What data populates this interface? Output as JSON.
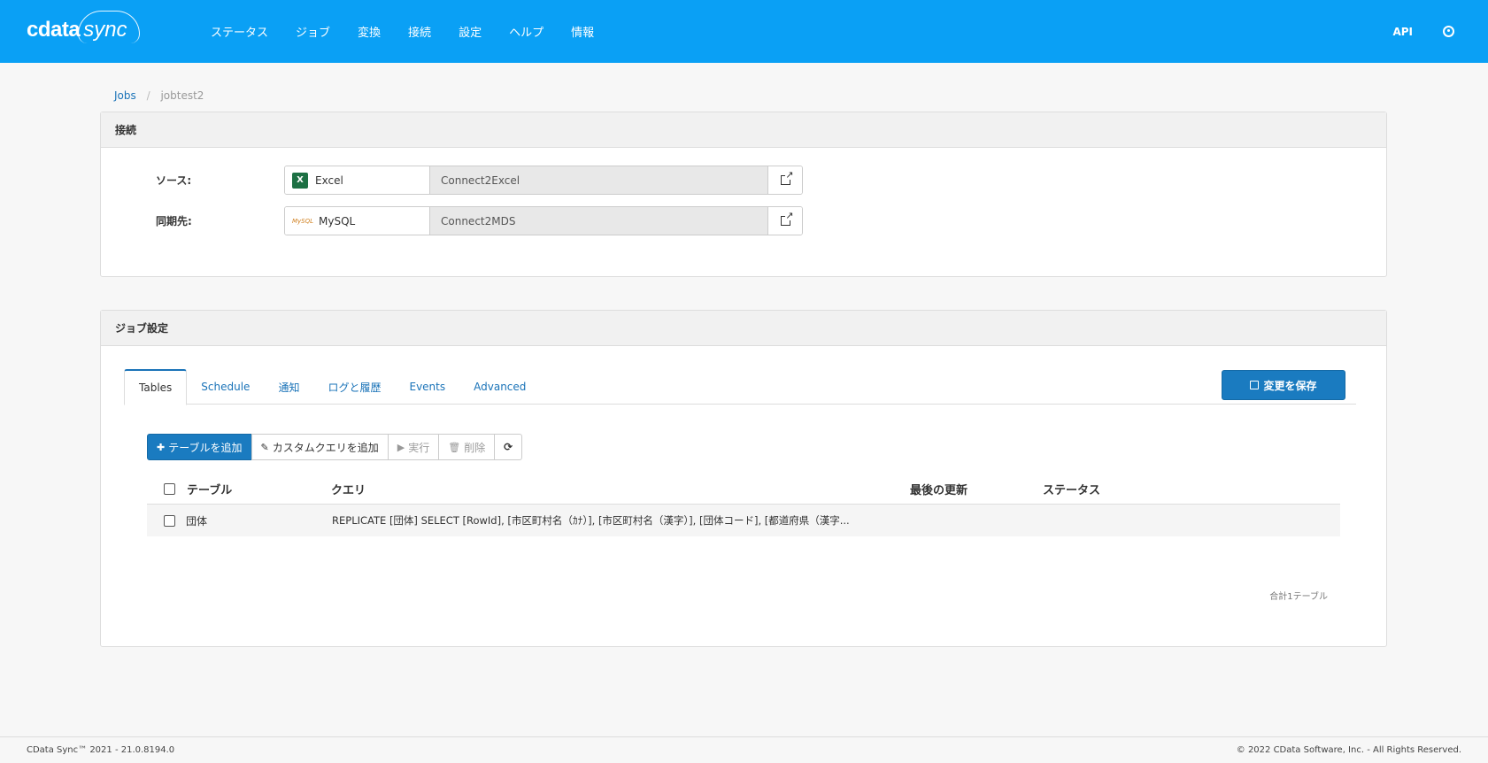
{
  "app": {
    "logo_main": "cdata",
    "logo_sub": "sync"
  },
  "nav": {
    "items": [
      "ステータス",
      "ジョブ",
      "変換",
      "接続",
      "設定",
      "ヘルプ",
      "情報"
    ],
    "api": "API"
  },
  "breadcrumb": {
    "root": "Jobs",
    "current": "jobtest2"
  },
  "connections": {
    "title": "接続",
    "source": {
      "label": "ソース:",
      "type": "Excel",
      "name": "Connect2Excel"
    },
    "destination": {
      "label": "同期先:",
      "type": "MySQL",
      "name": "Connect2MDS"
    }
  },
  "job_settings": {
    "title": "ジョブ設定",
    "tabs": [
      "Tables",
      "Schedule",
      "通知",
      "ログと履歴",
      "Events",
      "Advanced"
    ],
    "save_label": "変更を保存",
    "toolbar": {
      "add_table": "テーブルを追加",
      "add_custom_query": "カスタムクエリを追加",
      "run": "実行",
      "delete": "削除"
    },
    "table": {
      "headers": {
        "table": "テーブル",
        "query": "クエリ",
        "last_updated": "最後の更新",
        "status": "ステータス"
      },
      "rows": [
        {
          "table": "団体",
          "query": "REPLICATE [団体] SELECT [RowId], [市区町村名（ｶﾅ）], [市区町村名（漢字）], [団体コード], [都道府県（漢字...",
          "last_updated": "",
          "status": ""
        }
      ]
    },
    "total": "合計1テーブル"
  },
  "footer": {
    "version": "CData Sync™ 2021 - 21.0.8194.0",
    "copyright": "© 2022 CData Software, Inc. - All Rights Reserved."
  }
}
